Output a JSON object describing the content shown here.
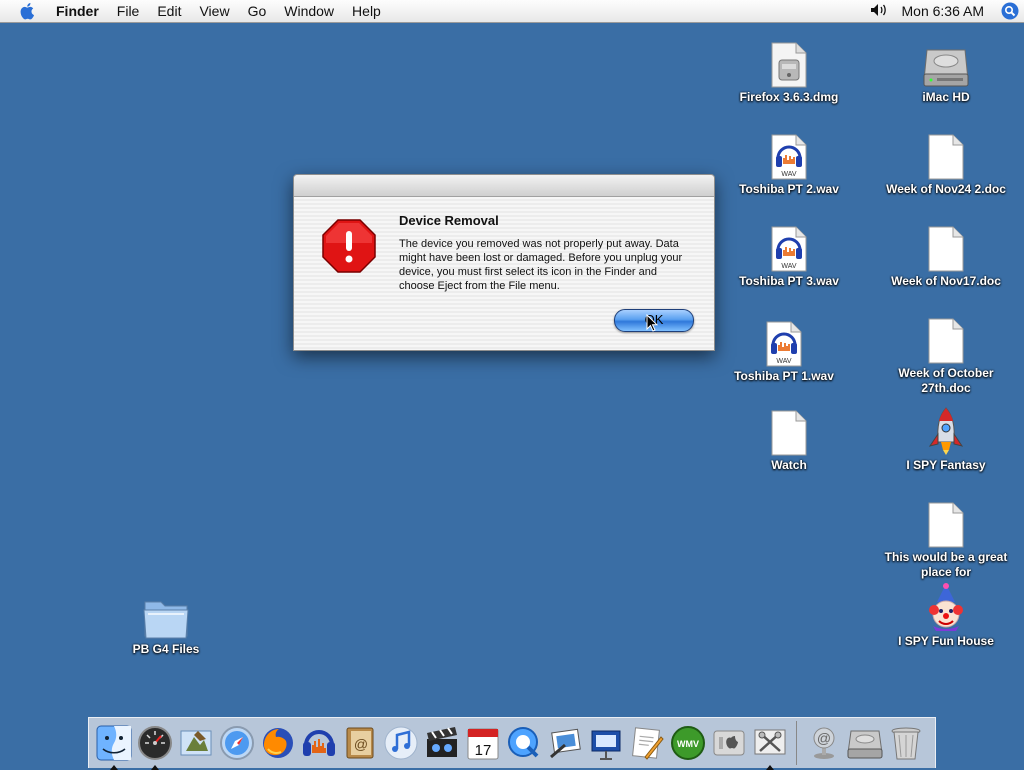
{
  "menubar": {
    "app_name": "Finder",
    "menus": [
      "File",
      "Edit",
      "View",
      "Go",
      "Window",
      "Help"
    ],
    "clock": "Mon 6:36 AM"
  },
  "desktop": {
    "items": [
      {
        "label": "Firefox 3.6.3.dmg",
        "icon": "disk-image-icon"
      },
      {
        "label": "iMac HD",
        "icon": "hard-drive-icon"
      },
      {
        "label": "Toshiba PT 2.wav",
        "icon": "wav-file-icon"
      },
      {
        "label": "Week of Nov24 2.doc",
        "icon": "document-icon"
      },
      {
        "label": "Toshiba PT 3.wav",
        "icon": "wav-file-icon"
      },
      {
        "label": "Week of Nov17.doc",
        "icon": "document-icon"
      },
      {
        "label": "Toshiba PT 1.wav",
        "icon": "wav-file-icon"
      },
      {
        "label": "Week of October 27th.doc",
        "icon": "document-icon"
      },
      {
        "label": "Watch",
        "icon": "document-icon"
      },
      {
        "label": "I SPY Fantasy",
        "icon": "rocket-icon"
      },
      {
        "label": "This would be a great place for",
        "icon": "document-icon"
      },
      {
        "label": "I SPY Fun House",
        "icon": "clown-icon"
      },
      {
        "label": "PB G4 Files",
        "icon": "folder-icon"
      }
    ]
  },
  "dialog": {
    "title": "Device Removal",
    "message": "The device you removed was not properly put away. Data might have been lost or damaged. Before you unplug your device, you must first select its icon in the Finder and choose Eject from the File menu.",
    "ok_label": "OK"
  },
  "dock": {
    "apps": [
      "finder-icon",
      "dashboard-icon",
      "mail-icon",
      "safari-icon",
      "firefox-icon",
      "audacity-icon",
      "address-book-icon",
      "itunes-icon",
      "imovie-icon",
      "ical-icon",
      "quicktime-icon",
      "preview-icon",
      "keynote-icon",
      "text-edit-icon",
      "wmv-player-icon",
      "system-preferences-icon",
      "grab-icon"
    ],
    "wmv_label": "WMV",
    "cal_day": "17",
    "right": [
      "internet-connect-icon",
      "hard-drive-icon",
      "trash-icon"
    ]
  }
}
